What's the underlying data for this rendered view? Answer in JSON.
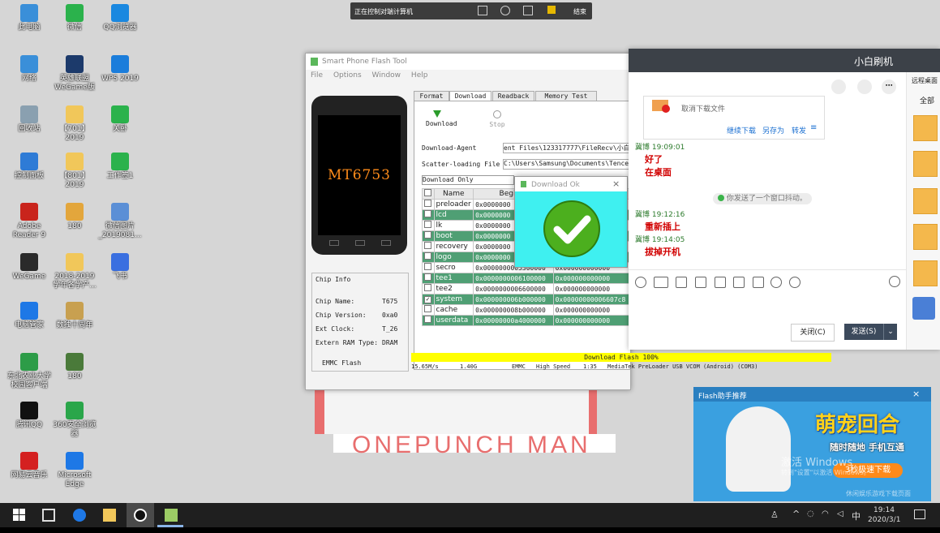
{
  "desktop": {
    "icons": [
      {
        "label": "此电脑",
        "color": "#3a8fd9"
      },
      {
        "label": "微信",
        "color": "#2bb24c"
      },
      {
        "label": "QQ浏览器",
        "color": "#1a88e0"
      },
      {
        "label": "网络",
        "color": "#3a8fd9"
      },
      {
        "label": "英雄联盟 WeGame版",
        "color": "#1c3a6b"
      },
      {
        "label": "WPS 2019",
        "color": "#1b7ddb"
      },
      {
        "label": "回收站",
        "color": "#8aa0b0"
      },
      {
        "label": "【701】 2019",
        "color": "#f1c75a"
      },
      {
        "label": "关卧",
        "color": "#2bb24c"
      },
      {
        "label": "控制面板",
        "color": "#2e7bd6"
      },
      {
        "label": "【801】 2019",
        "color": "#f1c75a"
      },
      {
        "label": "工作签1",
        "color": "#2bb24c"
      },
      {
        "label": "Adobe Reader 9",
        "color": "#c9241c"
      },
      {
        "label": "180",
        "color": "#e3a63c"
      },
      {
        "label": "微信图片_2019081...",
        "color": "#5b8fd6"
      },
      {
        "label": "WeGame",
        "color": "#2a2a2a"
      },
      {
        "label": "2018-2019 学年各学产...",
        "color": "#f1c75a"
      },
      {
        "label": "飞书",
        "color": "#3a6fe0"
      },
      {
        "label": "电脑管家",
        "color": "#1e78e6"
      },
      {
        "label": "数独十周年",
        "color": "#c8a050"
      },
      {
        "label": "东北农业大学 校园客户端",
        "color": "#2d9c48"
      },
      {
        "label": "180",
        "color": "#4a7a3a"
      },
      {
        "label": "腾讯QQ",
        "color": "#111111"
      },
      {
        "label": "360安全浏览器",
        "color": "#2aa64a"
      },
      {
        "label": "网易云音乐",
        "color": "#d42020"
      },
      {
        "label": "Microsoft Edge",
        "color": "#1e78e6"
      }
    ]
  },
  "remote_bar": {
    "text": "正在控制对端计算机",
    "end": "结束"
  },
  "sp_tool": {
    "title": "Smart Phone Flash Tool",
    "menu": [
      "File",
      "Options",
      "Window",
      "Help"
    ],
    "phone_label": "MT6753",
    "tabs": [
      "Format",
      "Download",
      "Readback",
      "Memory Test"
    ],
    "download_label": "Download",
    "stop_label": "Stop",
    "da_label": "Download-Agent",
    "da_value": "ent Files\\123317777\\FileRecv\\小白",
    "scatter_label": "Scatter-loading File",
    "scatter_value": "C:\\Users\\Samsung\\Documents\\Tence",
    "mode": "Download Only",
    "col_name": "Name",
    "col_begin": "Begin A",
    "partitions": [
      {
        "name": "preloader",
        "begin": "0x0000000",
        "end": "",
        "checked": false
      },
      {
        "name": "lcd",
        "begin": "0x0000000",
        "end": "",
        "checked": false
      },
      {
        "name": "lk",
        "begin": "0x0000000",
        "end": "",
        "checked": false
      },
      {
        "name": "boot",
        "begin": "0x0000000",
        "end": "",
        "checked": false
      },
      {
        "name": "recovery",
        "begin": "0x0000000",
        "end": "",
        "checked": false
      },
      {
        "name": "logo",
        "begin": "0x0000000",
        "end": "",
        "checked": false
      },
      {
        "name": "secro",
        "begin": "0x0000000005300000",
        "end": "0x000000000000",
        "checked": false
      },
      {
        "name": "tee1",
        "begin": "0x0000000006100000",
        "end": "0x000000000000",
        "checked": false
      },
      {
        "name": "tee2",
        "begin": "0x0000000006600000",
        "end": "0x000000000000",
        "checked": false
      },
      {
        "name": "system",
        "begin": "0x000000006b000000",
        "end": "0x00000000006607c8",
        "checked": true
      },
      {
        "name": "cache",
        "begin": "0x000000008b000000",
        "end": "0x000000000000",
        "checked": false
      },
      {
        "name": "userdata",
        "begin": "0x00000000a4000000",
        "end": "0x000000000000",
        "checked": false
      }
    ],
    "chip_info_title": "Chip Info",
    "chip": [
      {
        "k": "Chip Name:",
        "v": "T675"
      },
      {
        "k": "Chip Version:",
        "v": "0xa0"
      },
      {
        "k": "Ext Clock:",
        "v": "T_26"
      },
      {
        "k": "Extern RAM Type:",
        "v": "DRAM"
      }
    ],
    "emmc_label": "EMMC Flash",
    "progress_text": "Download Flash 100%",
    "progress": 1.0,
    "status": [
      "15.65M/s",
      "1.40G",
      "EMMC",
      "High Speed",
      "1:35",
      "MediaTek PreLoader USB VCOM (Android) (COM3)"
    ]
  },
  "dl_ok": {
    "title": "Download Ok",
    "close": "×"
  },
  "chat": {
    "title": "小白刷机",
    "file_cancel": "取消下载文件",
    "file_actions": [
      "继续下载",
      "另存为",
      "转发"
    ],
    "messages": [
      {
        "sender": "冀博",
        "time": "19:09:01",
        "lines": [
          "好了",
          "在桌面"
        ]
      },
      {
        "sender": "冀博",
        "time": "19:12:16",
        "lines": [
          "重新插上"
        ]
      },
      {
        "sender": "冀博",
        "time": "19:14:05",
        "lines": [
          "拔掉开机"
        ]
      }
    ],
    "system_notice": "你发送了一个窗口抖动。",
    "right_panel_title": "远程桌面",
    "right_panel_all": "全部",
    "close_btn": "关闭(C)",
    "send_btn": "发送(S)"
  },
  "wallpaper_text": "ONEPUNCH MAN",
  "ad": {
    "title": "Flash助手推荐",
    "headline": "萌宠回合",
    "sub": "随时随地 手机互通",
    "cta": "3秒极速下载",
    "watermark": "激活 Windows",
    "watermark_sub": "转到\"设置\"以激活 Windows。",
    "footer": "休闲娱乐游戏下载页面"
  },
  "taskbar": {
    "time": "19:14",
    "date": "2020/3/1",
    "ime": "中"
  }
}
